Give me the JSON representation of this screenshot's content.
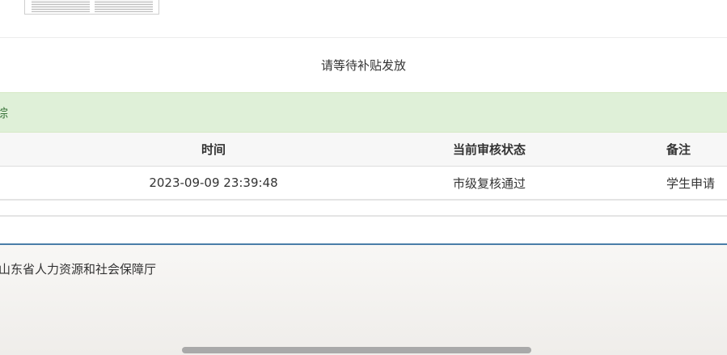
{
  "notice": {
    "text": "请等待补贴发放"
  },
  "tracking": {
    "title_partial": "综"
  },
  "table": {
    "headers": {
      "time": "时间",
      "status": "当前审核状态",
      "note": "备注"
    },
    "rows": [
      {
        "time": "2023-09-09 23:39:48",
        "status": "市级复核通过",
        "note": "学生申请"
      }
    ]
  },
  "footer": {
    "org_name_partial": "山东省人力资源和社会保障厅"
  }
}
